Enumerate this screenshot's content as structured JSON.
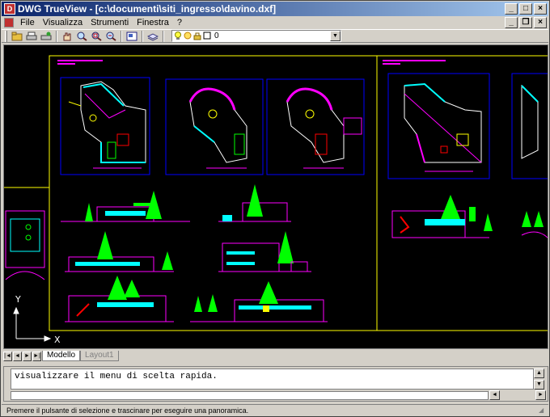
{
  "window": {
    "title": "DWG TrueView - [c:\\documenti\\siti_ingresso\\davino.dxf]",
    "controls": {
      "minimize": "_",
      "maximize": "□",
      "close": "×"
    }
  },
  "menubar": {
    "items": [
      "File",
      "Visualizza",
      "Strumenti",
      "Finestra",
      "?"
    ],
    "mdi_controls": {
      "minimize": "_",
      "restore": "❐",
      "close": "×"
    }
  },
  "toolbar": {
    "buttons": [
      "open-icon",
      "print-icon",
      "publish-icon",
      "pan-icon",
      "zoom-realtime-icon",
      "zoom-window-icon",
      "zoom-previous-icon",
      "named-views-icon",
      "layer-properties-icon"
    ],
    "layer_combo": {
      "value": "0",
      "icons": [
        "lightbulb-icon",
        "sun-icon",
        "lock-icon",
        "color-icon"
      ]
    }
  },
  "drawing": {
    "background": "#000000",
    "ucs": {
      "x_label": "X",
      "y_label": "Y"
    },
    "colors": {
      "walls": "#ff00ff",
      "lines": "#0000ff",
      "accent": "#ffff00",
      "cyan": "#00ffff",
      "green": "#00ff00",
      "red": "#ff0000",
      "white": "#ffffff"
    }
  },
  "layout_tabs": {
    "nav": [
      "|◄",
      "◄",
      "►",
      "►|"
    ],
    "tabs": [
      {
        "label": "Modello",
        "active": true
      },
      {
        "label": "Layout1",
        "active": false
      }
    ]
  },
  "command": {
    "output": "visualizzare il menu di scelta rapida.",
    "input": ""
  },
  "status": {
    "text": "Premere il pulsante di selezione e trascinare per eseguire una panoramica."
  }
}
